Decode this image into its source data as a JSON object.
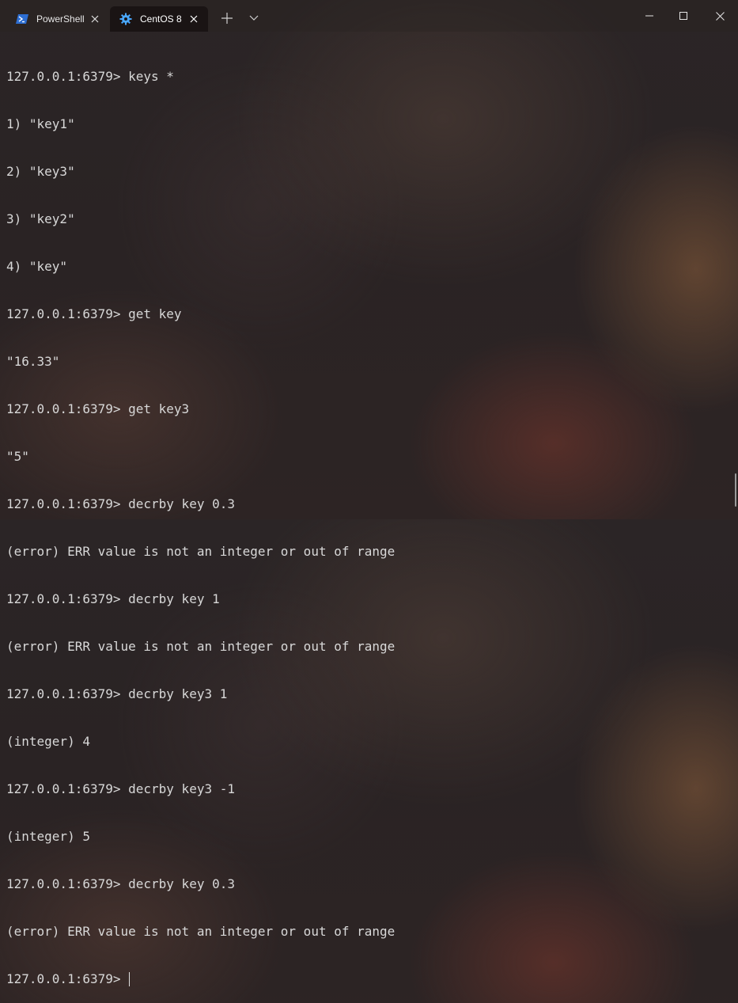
{
  "tabs": [
    {
      "label": "PowerShell",
      "icon": "powershell-icon",
      "active": false
    },
    {
      "label": "CentOS 8",
      "icon": "gear-icon",
      "active": true
    }
  ],
  "window_controls": [
    "minimize-icon",
    "maximize-icon",
    "close-icon"
  ],
  "terminal": {
    "lines": [
      "127.0.0.1:6379> keys *",
      "1) \"key1\"",
      "2) \"key3\"",
      "3) \"key2\"",
      "4) \"key\"",
      "127.0.0.1:6379> get key",
      "\"16.33\"",
      "127.0.0.1:6379> get key3",
      "\"5\"",
      "127.0.0.1:6379> decrby key 0.3",
      "(error) ERR value is not an integer or out of range",
      "127.0.0.1:6379> decrby key 1",
      "(error) ERR value is not an integer or out of range",
      "127.0.0.1:6379> decrby key3 1",
      "(integer) 4",
      "127.0.0.1:6379> decrby key3 -1",
      "(integer) 5",
      "127.0.0.1:6379> decrby key 0.3",
      "(error) ERR value is not an integer or out of range"
    ],
    "prompt": "127.0.0.1:6379> "
  },
  "colors": {
    "text": "#d8d8d8",
    "active_tab_bg": "#1a1414",
    "powershell_blue": "#2d6ed2",
    "centos_icon_blue": "#4aa8ff"
  }
}
